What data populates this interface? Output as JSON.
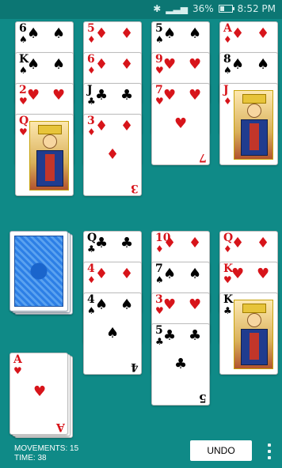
{
  "status_bar": {
    "battery_text": "36%",
    "time": "8:52 PM",
    "battery_level": 0.36
  },
  "foundations_or_top_tableau": [
    {
      "column": 1,
      "cards": [
        {
          "rank": "6",
          "suit": "♠",
          "color": "black"
        },
        {
          "rank": "K",
          "suit": "♠",
          "color": "black"
        },
        {
          "rank": "2",
          "suit": "♥",
          "color": "red"
        },
        {
          "rank": "Q",
          "suit": "♥",
          "color": "red"
        }
      ]
    },
    {
      "column": 2,
      "cards": [
        {
          "rank": "5",
          "suit": "♦",
          "color": "red"
        },
        {
          "rank": "6",
          "suit": "♦",
          "color": "red"
        },
        {
          "rank": "J",
          "suit": "♣",
          "color": "black"
        },
        {
          "rank": "3",
          "suit": "♦",
          "color": "red"
        }
      ]
    },
    {
      "column": 3,
      "cards": [
        {
          "rank": "5",
          "suit": "♠",
          "color": "black"
        },
        {
          "rank": "9",
          "suit": "♥",
          "color": "red"
        },
        {
          "rank": "7",
          "suit": "♥",
          "color": "red"
        }
      ]
    },
    {
      "column": 4,
      "cards": [
        {
          "rank": "A",
          "suit": "♦",
          "color": "red"
        },
        {
          "rank": "8",
          "suit": "♠",
          "color": "black"
        },
        {
          "rank": "J",
          "suit": "♦",
          "color": "red"
        }
      ]
    }
  ],
  "bottom_tableau": [
    {
      "column": 2,
      "cards": [
        {
          "rank": "Q",
          "suit": "♣",
          "color": "black"
        },
        {
          "rank": "4",
          "suit": "♦",
          "color": "red"
        },
        {
          "rank": "4",
          "suit": "♠",
          "color": "black"
        }
      ]
    },
    {
      "column": 3,
      "cards": [
        {
          "rank": "10",
          "suit": "♦",
          "color": "red"
        },
        {
          "rank": "7",
          "suit": "♠",
          "color": "black"
        },
        {
          "rank": "3",
          "suit": "♥",
          "color": "red"
        },
        {
          "rank": "5",
          "suit": "♣",
          "color": "black"
        }
      ]
    },
    {
      "column": 4,
      "cards": [
        {
          "rank": "Q",
          "suit": "♦",
          "color": "red"
        },
        {
          "rank": "K",
          "suit": "♥",
          "color": "red"
        },
        {
          "rank": "K",
          "suit": "♣",
          "color": "black"
        }
      ]
    }
  ],
  "waste_card": {
    "rank": "A",
    "suit": "♥",
    "color": "red"
  },
  "footer": {
    "movements_label": "MOVEMENTS: 15",
    "time_label": "TIME: 38",
    "undo_label": "UNDO"
  },
  "colors": {
    "felt": "#0f8a87",
    "status_bar": "#0c7673",
    "red_suit": "#d7141a",
    "card_back": "#2d7fe6"
  },
  "icons": [
    "bluetooth-icon",
    "signal-icon",
    "battery-icon",
    "overflow-menu-icon"
  ]
}
